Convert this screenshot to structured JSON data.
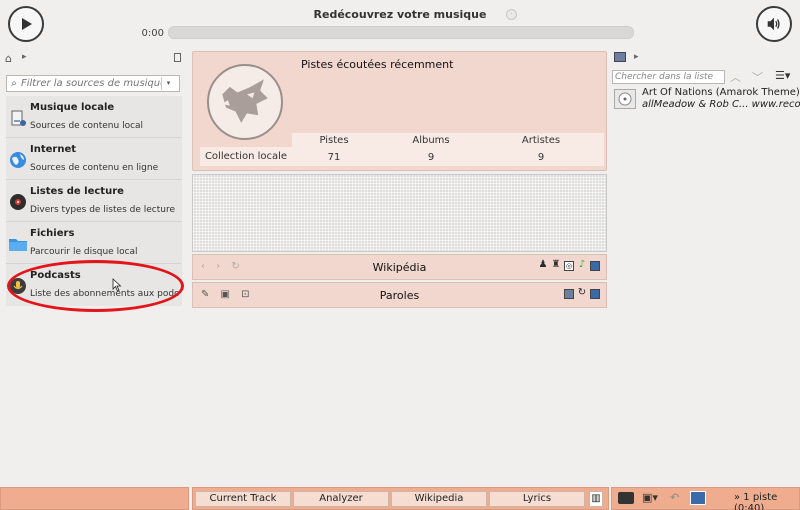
{
  "header": {
    "title": "Redécouvrez votre musique",
    "time_elapsed": "0:00"
  },
  "left_panel": {
    "search_placeholder": "Filtrer la sources de musique",
    "sources": [
      {
        "name": "Musique locale",
        "desc": "Sources de contenu local",
        "icon": "hard-drive-icon"
      },
      {
        "name": "Internet",
        "desc": "Sources de contenu en ligne",
        "icon": "globe-icon"
      },
      {
        "name": "Listes de lecture",
        "desc": "Divers types de listes de lecture",
        "icon": "vinyl-icon"
      },
      {
        "name": "Fichiers",
        "desc": "Parcourir le disque local",
        "icon": "folder-icon"
      },
      {
        "name": "Podcasts",
        "desc": "Liste des abonnements aux podc...",
        "icon": "podcast-icon"
      }
    ]
  },
  "center": {
    "recent_title": "Pistes écoutées récemment",
    "stats": {
      "headers": [
        "Pistes",
        "Albums",
        "Artistes"
      ],
      "row_label": "Collection locale",
      "values": [
        "71",
        "9",
        "9"
      ]
    },
    "wikipedia_label": "Wikipédia",
    "lyrics_label": "Paroles"
  },
  "right_panel": {
    "search_placeholder": "Chercher dans la liste",
    "track_title": "Art Of Nations (Amarok Theme)",
    "track_artist": "allMeadow & Rob C... www.reconstr"
  },
  "bottom": {
    "tabs": [
      "Current Track",
      "Analyzer",
      "Wikipedia",
      "Lyrics"
    ],
    "status": "» 1 piste (0:40)"
  },
  "colors": {
    "accent": "#efac8e",
    "panel": "#f2d7cf",
    "annotation": "#e3141b"
  }
}
